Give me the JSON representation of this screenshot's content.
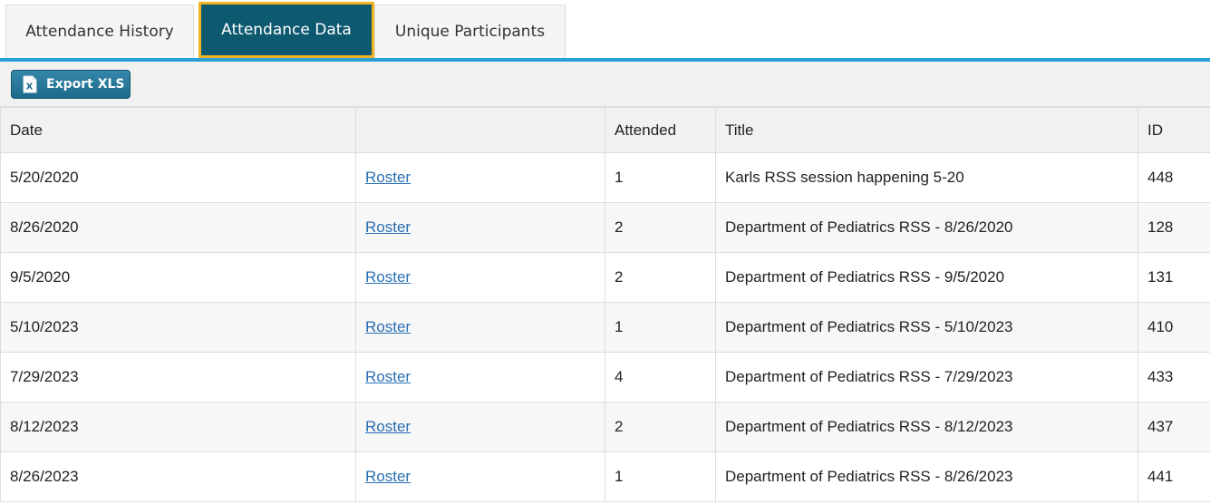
{
  "tabs": [
    {
      "label": "Attendance History",
      "active": false
    },
    {
      "label": "Attendance Data",
      "active": true
    },
    {
      "label": "Unique Participants",
      "active": false
    }
  ],
  "toolbar": {
    "export_label": "Export XLS",
    "export_icon": "excel-file-icon",
    "export_icon_glyph": "X"
  },
  "table": {
    "columns": [
      "Date",
      "",
      "Attended",
      "Title",
      "ID"
    ],
    "rows": [
      {
        "date": "5/20/2020",
        "link": "Roster",
        "attended": "1",
        "title": "Karls RSS session happening 5-20",
        "id": "448"
      },
      {
        "date": "8/26/2020",
        "link": "Roster",
        "attended": "2",
        "title": "Department of Pediatrics RSS - 8/26/2020",
        "id": "128"
      },
      {
        "date": "9/5/2020",
        "link": "Roster",
        "attended": "2",
        "title": "Department of Pediatrics RSS - 9/5/2020",
        "id": "131"
      },
      {
        "date": "5/10/2023",
        "link": "Roster",
        "attended": "1",
        "title": "Department of Pediatrics RSS - 5/10/2023",
        "id": "410"
      },
      {
        "date": "7/29/2023",
        "link": "Roster",
        "attended": "4",
        "title": "Department of Pediatrics RSS - 7/29/2023",
        "id": "433"
      },
      {
        "date": "8/12/2023",
        "link": "Roster",
        "attended": "2",
        "title": "Department of Pediatrics RSS - 8/12/2023",
        "id": "437"
      },
      {
        "date": "8/26/2023",
        "link": "Roster",
        "attended": "1",
        "title": "Department of Pediatrics RSS - 8/26/2023",
        "id": "441"
      }
    ]
  },
  "colors": {
    "active_tab": "#0d5970",
    "active_tab_border": "#f0b323",
    "tab_underline": "#2a9fd6",
    "button": "#1c6a8c",
    "link": "#2a6fb2"
  }
}
